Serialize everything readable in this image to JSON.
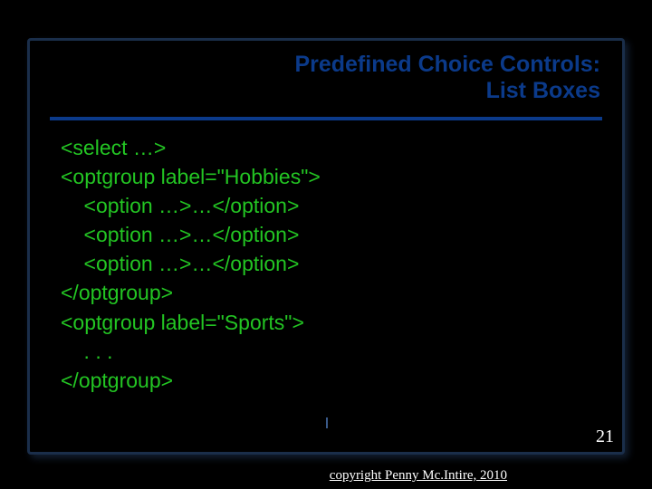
{
  "title": {
    "line1": "Predefined Choice Controls:",
    "line2": "List Boxes"
  },
  "code": {
    "l1": "<select …>",
    "l2": "<optgroup label=\"Hobbies\">",
    "l3": "    <option …>…</option>",
    "l4": "    <option …>…</option>",
    "l5": "    <option …>…</option>",
    "l6": "</optgroup>",
    "l7": "<optgroup label=\"Sports\">",
    "l8": "    . . .",
    "l9": "</optgroup>"
  },
  "page_number": "21",
  "copyright": "copyright Penny Mc.Intire, 2010"
}
